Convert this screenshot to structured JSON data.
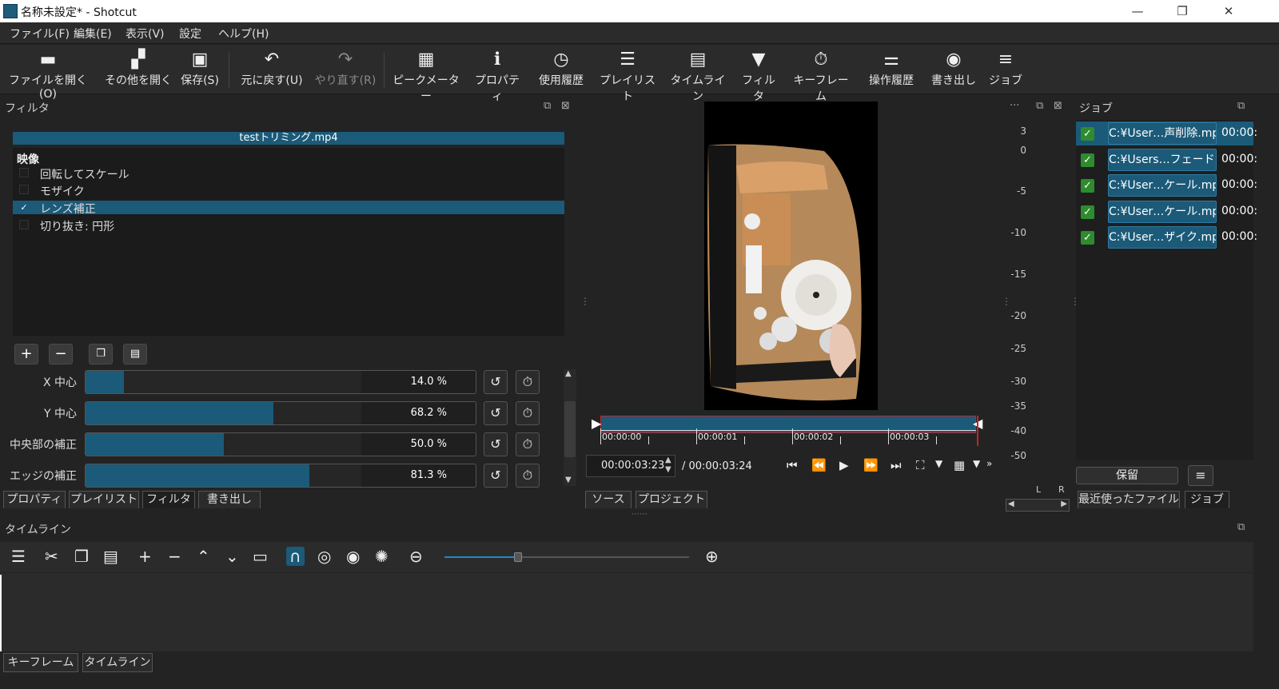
{
  "window": {
    "title": "名称未設定* - Shotcut",
    "minimize": "—",
    "restore": "❐",
    "close": "✕"
  },
  "menu": [
    "ファイル(F)",
    "編集(E)",
    "表示(V)",
    "設定",
    "ヘルプ(H)"
  ],
  "toolbar": [
    {
      "label": "ファイルを開く(O)",
      "icon": "folder-icon"
    },
    {
      "label": "その他を開く",
      "icon": "open-other-icon"
    },
    {
      "label": "保存(S)",
      "icon": "save-icon"
    },
    {
      "label": "元に戻す(U)",
      "icon": "undo-icon"
    },
    {
      "label": "やり直す(R)",
      "icon": "redo-icon"
    },
    {
      "label": "ピークメーター",
      "icon": "meter-icon"
    },
    {
      "label": "プロパティ",
      "icon": "info-icon"
    },
    {
      "label": "使用履歴",
      "icon": "clock-icon"
    },
    {
      "label": "プレイリスト",
      "icon": "list-icon"
    },
    {
      "label": "タイムライン",
      "icon": "timeline-icon"
    },
    {
      "label": "フィルタ",
      "icon": "filter-icon"
    },
    {
      "label": "キーフレーム",
      "icon": "stopwatch-icon"
    },
    {
      "label": "操作履歴",
      "icon": "history-icon"
    },
    {
      "label": "書き出し",
      "icon": "export-icon"
    },
    {
      "label": "ジョブ",
      "icon": "database-icon"
    }
  ],
  "filter_panel": {
    "header": "フィルタ",
    "file_name": "testトリミング.mp4",
    "category": "映像",
    "items": [
      {
        "label": "回転してスケール",
        "checked": false,
        "selected": false
      },
      {
        "label": "モザイク",
        "checked": false,
        "selected": false
      },
      {
        "label": "レンズ補正",
        "checked": true,
        "selected": true
      },
      {
        "label": "切り抜き: 円形",
        "checked": false,
        "selected": false
      }
    ],
    "check_mark": "✓",
    "params": [
      {
        "label": "X 中心",
        "value": "14.0 %",
        "fraction": 0.14
      },
      {
        "label": "Y 中心",
        "value": "68.2 %",
        "fraction": 0.682
      },
      {
        "label": "中央部の補正",
        "value": "50.0 %",
        "fraction": 0.5
      },
      {
        "label": "エッジの補正",
        "value": "81.3 %",
        "fraction": 0.813
      }
    ],
    "tabs": [
      "プロパティ",
      "プレイリスト",
      "フィルタ",
      "書き出し"
    ],
    "active_tab": "フィルタ"
  },
  "player": {
    "meter_scale": [
      "3",
      "0",
      "-5",
      "-10",
      "-15",
      "-20",
      "-25",
      "-30",
      "-35",
      "-40",
      "-50"
    ],
    "ruler_labels": [
      "00:00:00",
      "00:00:01",
      "00:00:02",
      "00:00:03"
    ],
    "current_time": "00:00:03:23",
    "total_time": "/ 00:00:03:24",
    "tabs": [
      "ソース",
      "プロジェクト"
    ],
    "lr_labels": [
      "L",
      "R"
    ],
    "menu_dots": "···"
  },
  "jobs_panel": {
    "header": "ジョブ",
    "jobs": [
      {
        "name": "C:¥User…声削除.mp4",
        "time": "00:00:"
      },
      {
        "name": "C:¥Users…フェード.mp4",
        "time": "00:00:"
      },
      {
        "name": "C:¥User…ケール.mp4",
        "time": "00:00:"
      },
      {
        "name": "C:¥User…ケール.mp4",
        "time": "00:00:"
      },
      {
        "name": "C:¥User…ザイク.mp4",
        "time": "00:00:"
      }
    ],
    "hold_button": "保留",
    "tabs": [
      "最近使ったファイル",
      "ジョブ"
    ]
  },
  "timeline": {
    "header": "タイムライン",
    "zoom_level": 0.3,
    "bottom_tabs": [
      "キーフレーム",
      "タイムライン"
    ]
  }
}
